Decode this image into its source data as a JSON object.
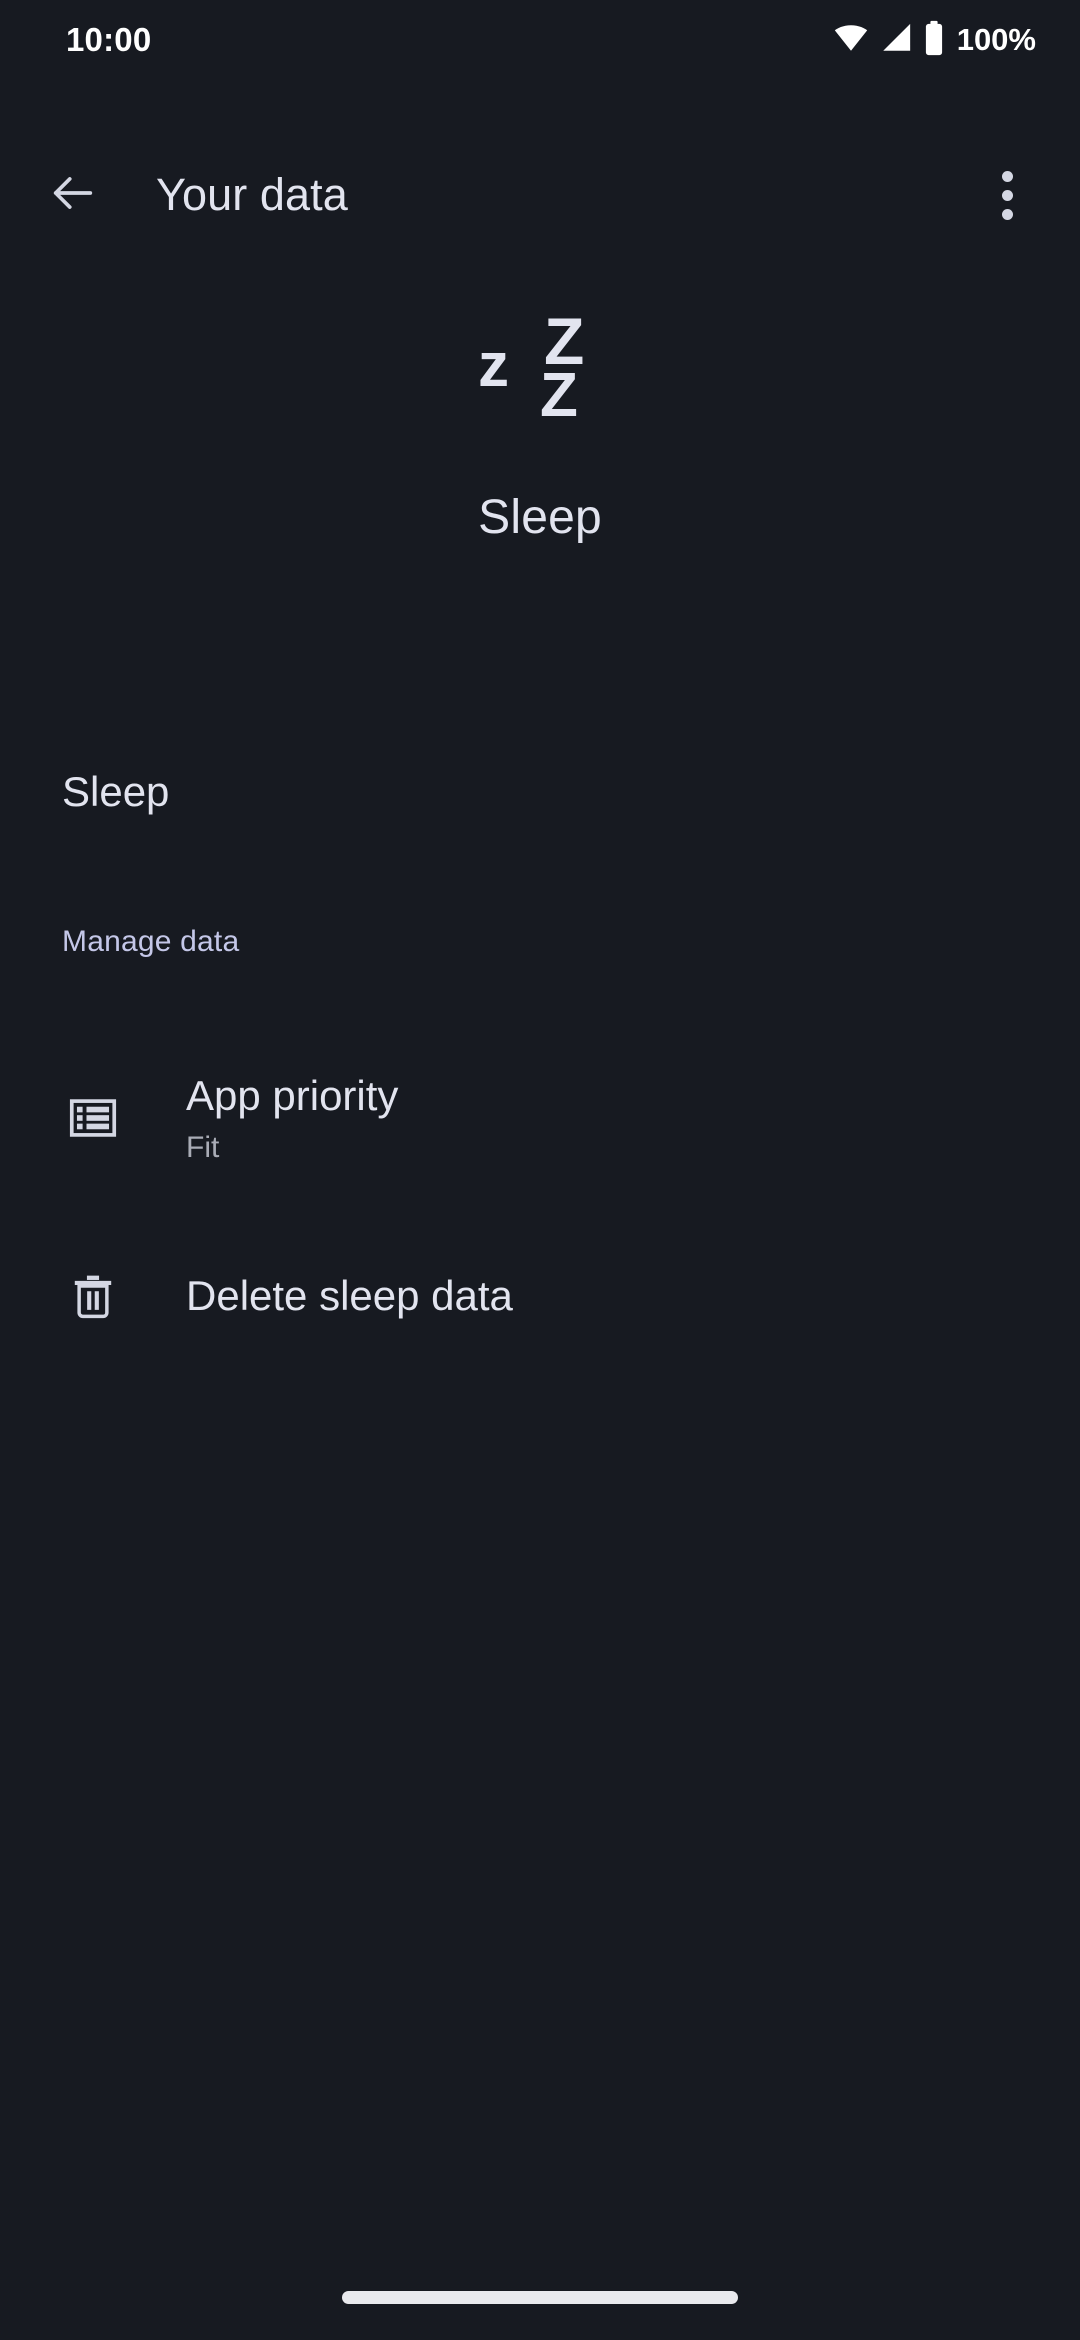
{
  "status_bar": {
    "time": "10:00",
    "battery_percent": "100%",
    "wifi_icon": "wifi-icon",
    "signal_icon": "cell-signal-icon",
    "battery_icon": "battery-full-icon"
  },
  "app_bar": {
    "back_icon": "back-arrow-icon",
    "title": "Your data",
    "overflow_icon": "overflow-menu-icon"
  },
  "hero": {
    "icon": "sleep-zzz-icon",
    "zs": [
      "z",
      "Z",
      "Z"
    ],
    "title": "Sleep"
  },
  "data_section": {
    "items": [
      {
        "label": "Sleep"
      }
    ]
  },
  "manage_section": {
    "header": "Manage data",
    "rows": [
      {
        "icon": "view-list-icon",
        "title": "App priority",
        "subtitle": "Fit"
      },
      {
        "icon": "trash-delete-icon",
        "title": "Delete sleep data",
        "subtitle": ""
      }
    ]
  },
  "navigation": {
    "gesture_pill": "home-gesture-pill"
  },
  "colors": {
    "background": "#171A21",
    "primary_text": "#E2E4EF",
    "secondary_text": "#A9ACB6",
    "accent": "#C4C7E8",
    "status_text": "#FFFFFF"
  }
}
